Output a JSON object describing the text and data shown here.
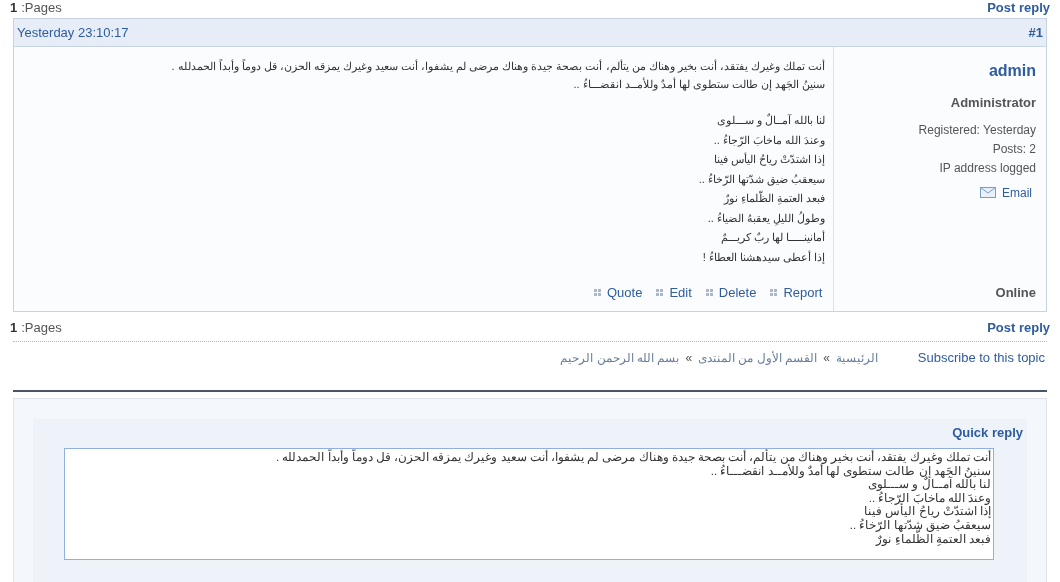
{
  "top_pagination": {
    "page": "1",
    "pages_label": ":Pages",
    "post_reply": "Post reply"
  },
  "post": {
    "time": "Yesterday 23:10:17",
    "number": "#1",
    "author": {
      "name": "admin",
      "title": "Administrator",
      "registered": "Registered: Yesterday",
      "posts": "Posts: 2",
      "ip": "IP address logged",
      "email": "Email",
      "status": "Online"
    },
    "paragraphs": [
      "أنت تملك وغيرك يفتقد، أنت بخير وهناك من يتألم، أنت بصحة جيدة وهناك مرضى لم يشفوا، أنت سعيد وغيرك يمزقه الحزن، قل دوماً وأبداً الحمدلله .",
      "سنينُ الجَهد إن طالت ستطوى لها أمدٌ وللأمــد انقضـــاءُ .."
    ],
    "poem": [
      "لنا بالله آمــالٌ و ســـلوى",
      "وعندَ الله ماخابَ الرّجاءُ ..",
      "إذا اشتدّتْ رياحُ اليأس فينا",
      "سيعقبُ ضيق شدّتها الرّخاءُ ..",
      "فبعد العتمةِ الظّلماءِ نورٌ",
      "وطولُ الليلِ يعقبهُ الضياءُ ..",
      "أمانينـــــا لها ربٌ كريـــمٌ",
      "إذا أعطى سيدهشنا العطاءُ !"
    ],
    "actions": [
      "Report",
      "Delete",
      "Edit",
      "Quote"
    ]
  },
  "bottom_pagination": {
    "page": "1",
    "pages_label": ":Pages",
    "post_reply": "Post reply"
  },
  "breadcrumbs": [
    {
      "kind": "link",
      "text": "الرئيسية"
    },
    {
      "kind": "separator",
      "text": "»"
    },
    {
      "kind": "link",
      "text": "القسم الأول من المنتدى"
    },
    {
      "kind": "separator",
      "text": "»"
    },
    {
      "kind": "link",
      "text": "بسم الله الرحمن الرحيم"
    }
  ],
  "subscribe": "Subscribe to this topic",
  "quick_reply": {
    "title": "Quick reply",
    "lines": [
      "أنت تملك وغيرك يفتقد، أنت بخير وهناك من يتألم، أنت بصحة جيدة وهناك مرضى لم يشفوا، أنت سعيد وغيرك يمزقه الحزن، قل دوماً وأبداً الحمدلله .",
      "سنينُ الجَهد إن طالت ستطوى لها أمدٌ وللأمــد انقضـــاءُ ..",
      "لنا بالله آمــالٌ و ســـلوى",
      "وعندَ الله ماخابَ الرّجاءُ ..",
      "إذا اشتدّتْ رياحُ اليأس فينا",
      "سيعقبُ ضيق شدّتها الرّخاءُ ..",
      "فبعد العتمةِ الظّلماءِ نورٌ"
    ]
  }
}
